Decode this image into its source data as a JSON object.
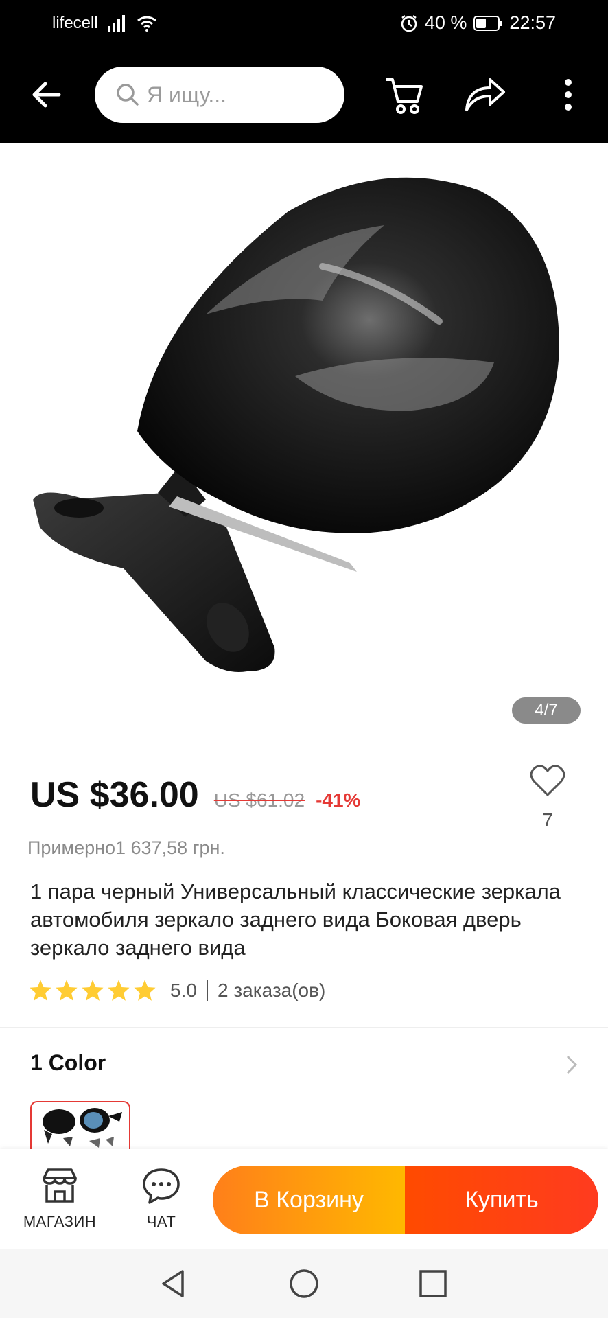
{
  "status_bar": {
    "carrier": "lifecell",
    "battery": "40 %",
    "time": "22:57"
  },
  "header": {
    "search_placeholder": "Я ищу..."
  },
  "gallery": {
    "counter": "4/7"
  },
  "product": {
    "price": "US $36.00",
    "old_price": "US $61.02",
    "discount": "-41%",
    "wishlist_count": "7",
    "approx_price": "Примерно1 637,58 грн.",
    "title": "1 пара черный Универсальный классические зеркала автомобиля зеркало заднего вида Боковая дверь зеркало заднего вида",
    "rating": "5.0",
    "rating_stars": 5,
    "orders": "2 заказа(ов)"
  },
  "options": {
    "color_label": "1 Color"
  },
  "action_bar": {
    "store_label": "МАГАЗИН",
    "chat_label": "ЧАТ",
    "cart_button": "В Корзину",
    "buy_button": "Купить"
  },
  "colors": {
    "accent_red": "#e53935",
    "cart_gradient": [
      "#ff7f1a",
      "#ffb800"
    ],
    "buy_gradient": [
      "#ff4b00",
      "#ff3b1f"
    ],
    "star": "#ffcc33"
  }
}
